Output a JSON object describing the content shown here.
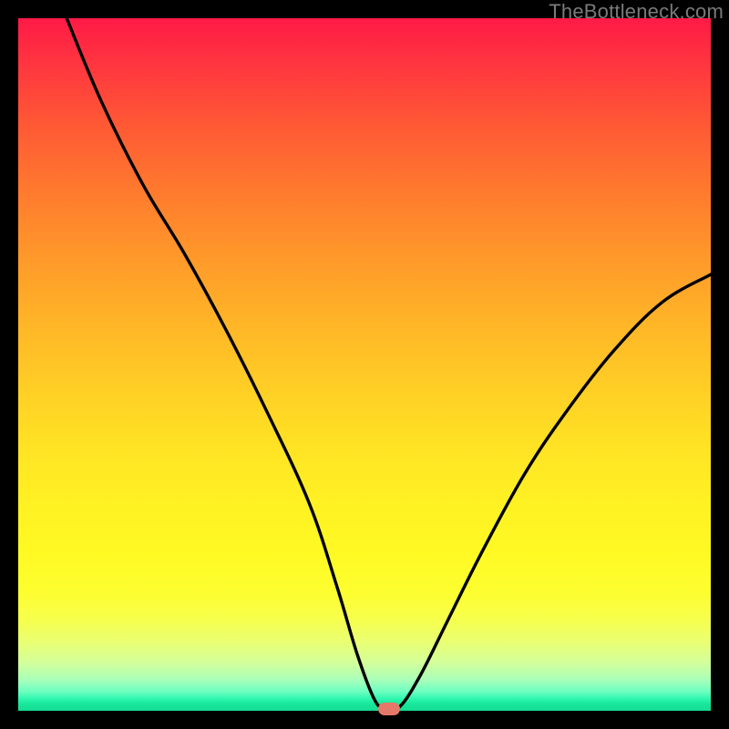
{
  "watermark": "TheBottleneck.com",
  "chart_data": {
    "type": "line",
    "title": "",
    "xlabel": "",
    "ylabel": "",
    "xlim": [
      0,
      100
    ],
    "ylim": [
      0,
      100
    ],
    "grid": false,
    "series": [
      {
        "name": "bottleneck-curve",
        "x": [
          7,
          12,
          18,
          24,
          30,
          36,
          42,
          46,
          49,
          51.5,
          53,
          55,
          58,
          62,
          67,
          73,
          79,
          86,
          93,
          100
        ],
        "values": [
          100,
          88,
          76,
          66,
          55,
          43,
          30,
          18,
          8,
          1.5,
          0.5,
          0.5,
          5,
          13,
          23,
          34,
          43,
          52,
          59,
          63
        ]
      }
    ],
    "marker": {
      "x": 53.5,
      "y": 0.3,
      "color": "#e6786a"
    },
    "gradient_stops": [
      {
        "offset": 0,
        "color": "#ff1a46"
      },
      {
        "offset": 0.5,
        "color": "#ffd225"
      },
      {
        "offset": 0.9,
        "color": "#f6ff4e"
      },
      {
        "offset": 1.0,
        "color": "#15dc93"
      }
    ]
  }
}
